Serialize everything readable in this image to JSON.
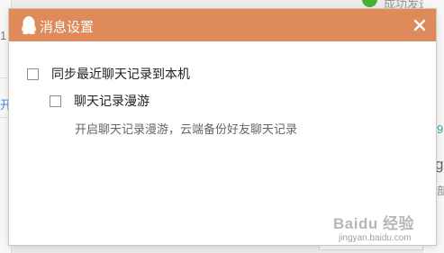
{
  "background": {
    "status_text": "成功发送照",
    "left_fragment_1": "1",
    "left_fragment_2": "开",
    "right_fragment_1": "9",
    "right_fragment_2": "g",
    "right_fragment_3": "部"
  },
  "dialog": {
    "title": "消息设置",
    "title_icon": "qq-penguin-icon",
    "close_icon": "close-icon",
    "options": [
      {
        "label": "同步最近聊天记录到本机",
        "checked": false
      },
      {
        "label": "聊天记录漫游",
        "checked": false
      }
    ],
    "roaming_description": "开启聊天记录漫游，云端备份好友聊天记录"
  },
  "watermark": {
    "text": "Baidu 经验",
    "url": "jingyan.baidu.com"
  },
  "colors": {
    "titlebar": "#de8a5a",
    "title_text": "#ffffff",
    "status_check": "#46b036"
  }
}
